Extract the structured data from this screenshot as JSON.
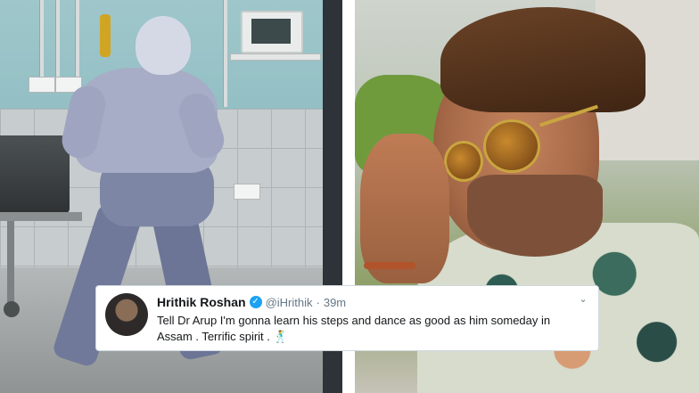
{
  "tweet": {
    "name": "Hrithik Roshan",
    "handle": "@iHrithik",
    "separator": "·",
    "time": "39m",
    "text_line1": "Tell Dr Arup I'm gonna learn his steps and dance as good as him someday in",
    "text_line2": "Assam . Terrific spirit .",
    "emoji": "🕺",
    "verified_icon": "verified-badge-icon",
    "menu_icon": "chevron-down-icon"
  },
  "colors": {
    "verified": "#1da1f2",
    "name_text": "#14171a",
    "meta_text": "#657786",
    "card_border": "#cfd9de"
  }
}
